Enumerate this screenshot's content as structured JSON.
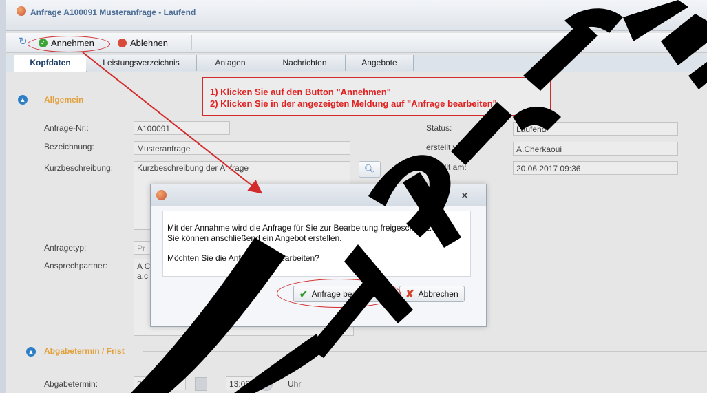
{
  "window": {
    "title": "Anfrage A100091 Musteranfrage - Laufend"
  },
  "toolbar": {
    "accept_label": "Annehmen",
    "reject_label": "Ablehnen"
  },
  "tabs": [
    {
      "label": "Kopfdaten"
    },
    {
      "label": "Leistungsverzeichnis"
    },
    {
      "label": "Anlagen"
    },
    {
      "label": "Nachrichten"
    },
    {
      "label": "Angebote"
    }
  ],
  "section_general": {
    "title": "Allgemein"
  },
  "section_deadline": {
    "title": "Abgabetermin / Frist"
  },
  "form": {
    "anfrage_nr_label": "Anfrage-Nr.:",
    "anfrage_nr_value": "A100091",
    "bezeichnung_label": "Bezeichnung:",
    "bezeichnung_value": "Musteranfrage",
    "kurzbeschreibung_label": "Kurzbeschreibung:",
    "kurzbeschreibung_value": "Kurzbeschreibung der Anfrage",
    "anfragetyp_label": "Anfragetyp:",
    "anfragetyp_value": "Pr",
    "ansprechpartner_label": "Ansprechpartner:",
    "ansprechpartner_line1": "A C",
    "ansprechpartner_line2": "a.c",
    "status_label": "Status:",
    "status_value": "Laufend",
    "erstellt_von_label": "erstellt von:",
    "erstellt_von_value": "A.Cherkaoui",
    "erstellt_am_label": "erstellt am:",
    "erstellt_am_value": "20.06.2017 09:36",
    "abgabetermin_label": "Abgabetermin:",
    "abgabetermin_date": "22.06.2017",
    "abgabetermin_time": "13:00",
    "uhr_label": "Uhr"
  },
  "callout": {
    "line1": "1) Klicken Sie auf den Button \"Annehmen\"",
    "line2": "2) Klicken Sie in der angezeigten Meldung auf \"Anfrage bearbeiten\""
  },
  "dialog": {
    "message_line1": "Mit der Annahme wird die Anfrage für Sie zur Bearbeitung freigeschaltet.",
    "message_line2": "Sie können anschließend ein Angebot erstellen.",
    "question": "Möchten Sie die Anfrage nun bearbeiten?",
    "confirm_label": "Anfrage bearbeiten",
    "cancel_label": "Abbrechen"
  },
  "colors": {
    "annotation_red": "#d32b2b",
    "watermark": "#000000",
    "section_orange": "#e2a03a"
  },
  "watermark": {
    "text": "exemplar"
  }
}
